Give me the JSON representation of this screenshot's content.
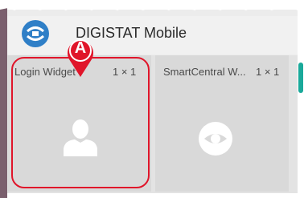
{
  "app": {
    "title": "DIGISTAT Mobile"
  },
  "widgets": [
    {
      "name": "Login Widget",
      "size": "1 × 1",
      "icon": "person-icon"
    },
    {
      "name": "SmartCentral W...",
      "size": "1 × 1",
      "icon": "eye-icon"
    }
  ],
  "annotation": {
    "marker": "A",
    "color": "#e0152a"
  },
  "colors": {
    "accent": "#1aa99a",
    "app_icon": "#2f7fc7",
    "tile_icon": "#ffffff"
  }
}
